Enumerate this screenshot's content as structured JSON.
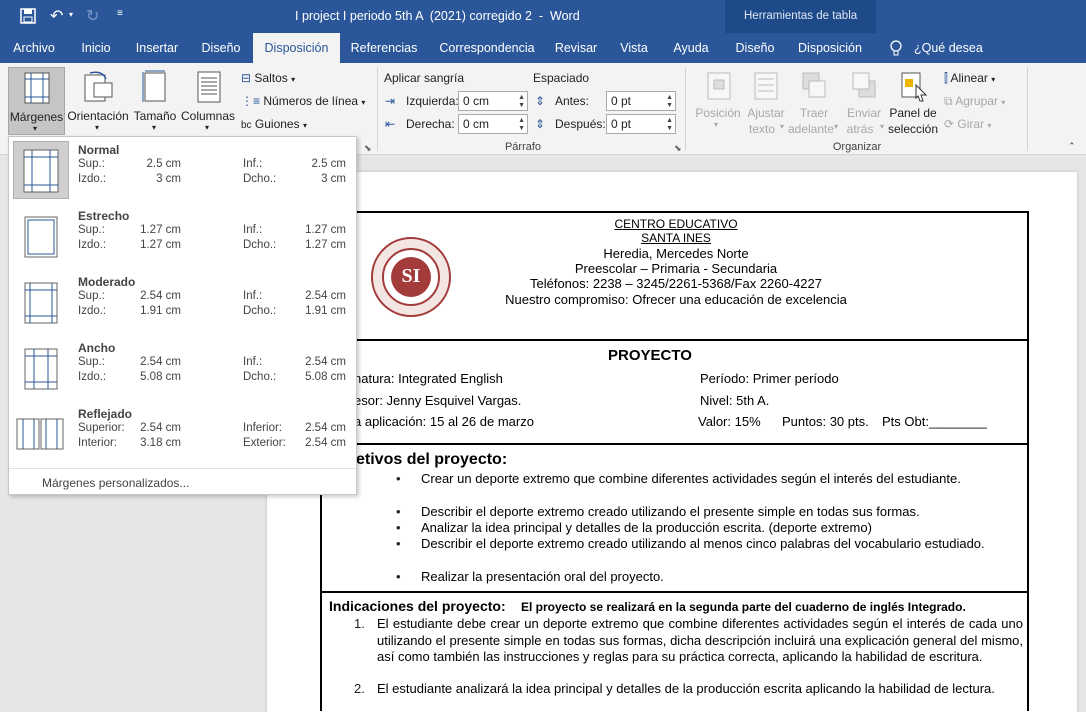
{
  "titlebar": {
    "doc_title": "I project I periodo 5th A  (2021) corregido 2  -  Word",
    "context_title": "Herramientas de tabla"
  },
  "tabs": [
    "Archivo",
    "Inicio",
    "Insertar",
    "Diseño",
    "Disposición",
    "Referencias",
    "Correspondencia",
    "Revisar",
    "Vista",
    "Ayuda",
    "Diseño",
    "Disposición"
  ],
  "tell_me": "¿Qué desea hacer?",
  "ribbon": {
    "margins_label": "Márgenes",
    "orientation_label": "Orientación",
    "size_label": "Tamaño",
    "columns_label": "Columnas",
    "breaks_label": "Saltos",
    "line_numbers_label": "Números de línea",
    "hyphenation_label": "Guiones",
    "indent_header": "Aplicar sangría",
    "indent_left_label": "Izquierda:",
    "indent_left_value": "0 cm",
    "indent_right_label": "Derecha:",
    "indent_right_value": "0 cm",
    "spacing_header": "Espaciado",
    "spacing_before_label": "Antes:",
    "spacing_before_value": "0 pt",
    "spacing_after_label": "Después:",
    "spacing_after_value": "0 pt",
    "paragraph_group": "Párrafo",
    "position_label": "Posición",
    "wrap_label_1": "Ajustar",
    "wrap_label_2": "texto",
    "forward_label_1": "Traer",
    "forward_label_2": "adelante",
    "backward_label_1": "Enviar",
    "backward_label_2": "atrás",
    "selection_label_1": "Panel de",
    "selection_label_2": "selección",
    "align_label": "Alinear",
    "group_label": "Agrupar",
    "rotate_label": "Girar",
    "arrange_group": "Organizar"
  },
  "margins_menu": {
    "items": [
      {
        "name": "Normal",
        "l1": "Sup.:",
        "v1": "2.5 cm",
        "l2": "Inf.:",
        "v2": "2.5 cm",
        "l3": "Izdo.:",
        "v3": "3 cm",
        "l4": "Dcho.:",
        "v4": "3 cm"
      },
      {
        "name": "Estrecho",
        "l1": "Sup.:",
        "v1": "1.27 cm",
        "l2": "Inf.:",
        "v2": "1.27 cm",
        "l3": "Izdo.:",
        "v3": "1.27 cm",
        "l4": "Dcho.:",
        "v4": "1.27 cm"
      },
      {
        "name": "Moderado",
        "l1": "Sup.:",
        "v1": "2.54 cm",
        "l2": "Inf.:",
        "v2": "2.54 cm",
        "l3": "Izdo.:",
        "v3": "1.91 cm",
        "l4": "Dcho.:",
        "v4": "1.91 cm"
      },
      {
        "name": "Ancho",
        "l1": "Sup.:",
        "v1": "2.54 cm",
        "l2": "Inf.:",
        "v2": "2.54 cm",
        "l3": "Izdo.:",
        "v3": "5.08 cm",
        "l4": "Dcho.:",
        "v4": "5.08 cm"
      },
      {
        "name": "Reflejado",
        "l1": "Superior:",
        "v1": "2.54 cm",
        "l2": "Inferior:",
        "v2": "2.54 cm",
        "l3": "Interior:",
        "v3": "3.18 cm",
        "l4": "Exterior:",
        "v4": "2.54 cm"
      }
    ],
    "custom_label": "Márgenes personalizados..."
  },
  "document": {
    "header_lines": [
      "CENTRO EDUCATIVO",
      "SANTA INES",
      "Heredia, Mercedes Norte",
      "Preescolar – Primaria - Secundaria",
      "Teléfonos: 2238 – 3245/2261-5368/Fax 2260-4227",
      "Nuestro compromiso: Ofrecer una educación de excelencia"
    ],
    "logo_text": "SI",
    "title": "PROYECTO",
    "info": {
      "subject": "natura: Integrated English",
      "teacher": "esor: Jenny Esquivel Vargas.",
      "dates": "a aplicación: 15 al 26 de marzo",
      "period": "Período: Primer período",
      "level": "Nivel: 5th A.",
      "value": "Valor: 15%",
      "points": "Puntos: 30 pts.",
      "obtained": "Pts Obt:________"
    },
    "objectives_title": "etivos del proyecto:",
    "objectives": [
      "Crear un deporte extremo que combine diferentes actividades según el interés del estudiante.",
      "Describir el deporte extremo creado utilizando el presente simple en todas sus formas.",
      "Analizar la idea principal y detalles de la producción escrita. (deporte extremo)",
      "Describir el deporte extremo creado utilizando al menos cinco palabras del vocabulario estudiado.",
      "Realizar la presentación oral del proyecto."
    ],
    "indications_title": "Indicaciones del proyecto:",
    "indications_note": "El proyecto se realizará en la segunda parte del cuaderno de inglés Integrado.",
    "indications": [
      "El estudiante debe crear un deporte extremo que combine diferentes actividades según el interés de cada uno utilizando el presente simple en todas sus formas, dicha descripción incluirá una explicación general del mismo, así como también las instrucciones y reglas para su práctica correcta, aplicando la habilidad de escritura.",
      "El estudiante analizará la idea principal y detalles de la producción escrita aplicando la habilidad de lectura."
    ]
  },
  "colors": {
    "brand": "#2b579a",
    "context": "#1f4a8a"
  }
}
